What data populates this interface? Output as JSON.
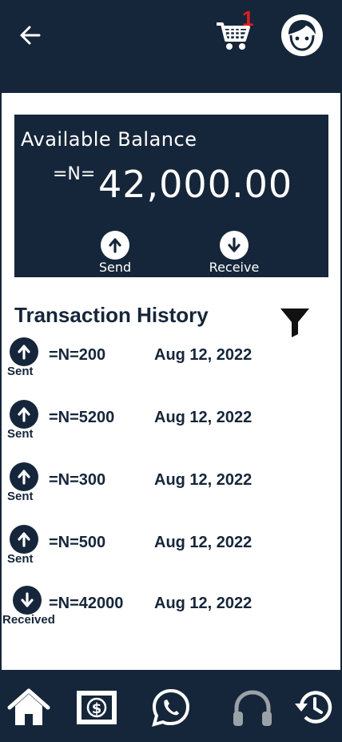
{
  "header": {
    "cart_badge": "1"
  },
  "balance": {
    "label": "Available Balance",
    "currency": "=N=",
    "amount": "42,000.00",
    "send_label": "Send",
    "receive_label": "Receive"
  },
  "history": {
    "title": "Transaction History",
    "items": [
      {
        "direction": "up",
        "type": "Sent",
        "amount": "=N=200",
        "date": "Aug 12, 2022"
      },
      {
        "direction": "up",
        "type": "Sent",
        "amount": "=N=5200",
        "date": "Aug 12, 2022"
      },
      {
        "direction": "up",
        "type": "Sent",
        "amount": "=N=300",
        "date": "Aug 12, 2022"
      },
      {
        "direction": "up",
        "type": "Sent",
        "amount": "=N=500",
        "date": "Aug 12, 2022"
      },
      {
        "direction": "down",
        "type": "Received",
        "amount": "=N=42000",
        "date": "Aug 12, 2022"
      }
    ]
  },
  "icons": {
    "back": "arrow-left-icon",
    "cart": "cart-icon",
    "avatar": "face-icon",
    "filter": "filter-icon",
    "nav": [
      "home-icon",
      "money-icon",
      "whatsapp-icon",
      "headphones-icon",
      "history-icon"
    ]
  },
  "colors": {
    "primary": "#16263a",
    "badge": "#e11d1d",
    "background": "#ffffff"
  }
}
